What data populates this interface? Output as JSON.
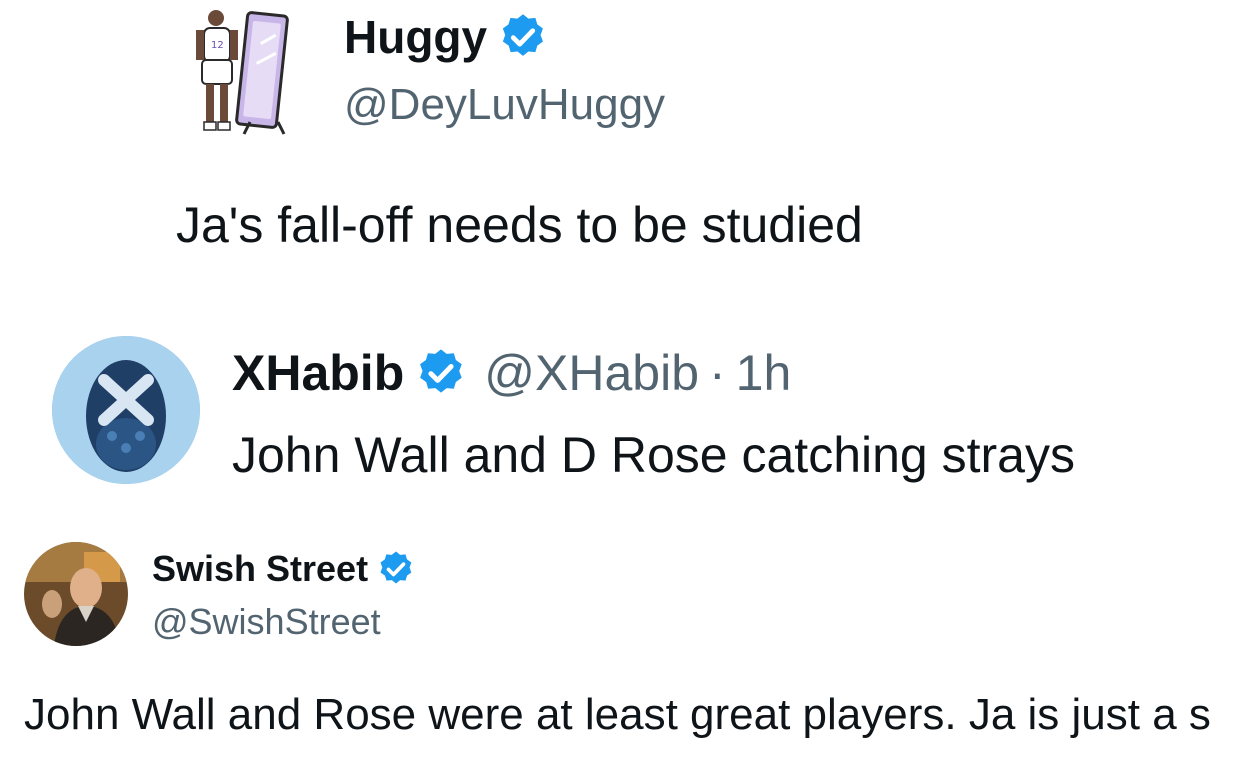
{
  "tweets": [
    {
      "author_name": "Huggy",
      "handle": "@DeyLuvHuggy",
      "verified": true,
      "text": "Ja's fall-off needs to be studied",
      "avatar_icon": "basketball-player-mirror-illustration"
    },
    {
      "author_name": "XHabib",
      "handle": "@XHabib",
      "separator": "·",
      "time": "1h",
      "verified": true,
      "text": "John Wall and D Rose catching strays",
      "avatar_icon": "blue-statue-x-avatar"
    },
    {
      "author_name": "Swish Street",
      "handle": "@SwishStreet",
      "verified": true,
      "text": "John Wall and Rose were at least great players. Ja is just a  s",
      "avatar_icon": "photo-avatar"
    }
  ],
  "colors": {
    "verified_blue": "#1d9bf0",
    "text_primary": "#0f1419",
    "text_secondary": "#536471"
  }
}
